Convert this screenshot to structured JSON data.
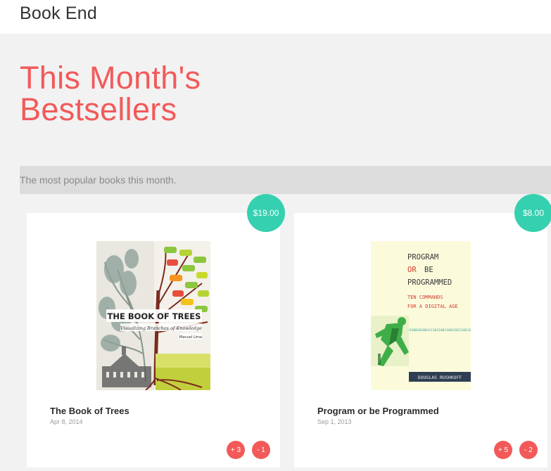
{
  "app": {
    "title": "Book End"
  },
  "hero": {
    "title_line1": "This Month's",
    "title_line2": "Bestsellers"
  },
  "subtitle": "The most popular books this month.",
  "colors": {
    "accent": "#f25a5a",
    "price_badge": "#35d0b0",
    "background": "#f2f2f2"
  },
  "books": [
    {
      "title": "The Book of Trees",
      "date": "Apr 8, 2014",
      "price": "$19.00",
      "upvote_label": "+ 3",
      "downvote_label": "- 1",
      "cover": {
        "title": "THE BOOK OF TREES",
        "subtitle": "Visualizing Branches of Knowledge",
        "author": "Manuel Lima"
      }
    },
    {
      "title": "Program or be Programmed",
      "date": "Sep 1, 2013",
      "price": "$8.00",
      "upvote_label": "+ 5",
      "downvote_label": "- 2",
      "cover": {
        "line1": "PROGRAM",
        "line2a": "OR",
        "line2b": "BE",
        "line3": "PROGRAMMED",
        "sub1": "TEN COMMANDS",
        "sub2": "FOR A DIGITAL AGE",
        "binary": "0110010100111101100110011011101100",
        "author": "DOUGLAS RUSHKOFF"
      }
    }
  ]
}
